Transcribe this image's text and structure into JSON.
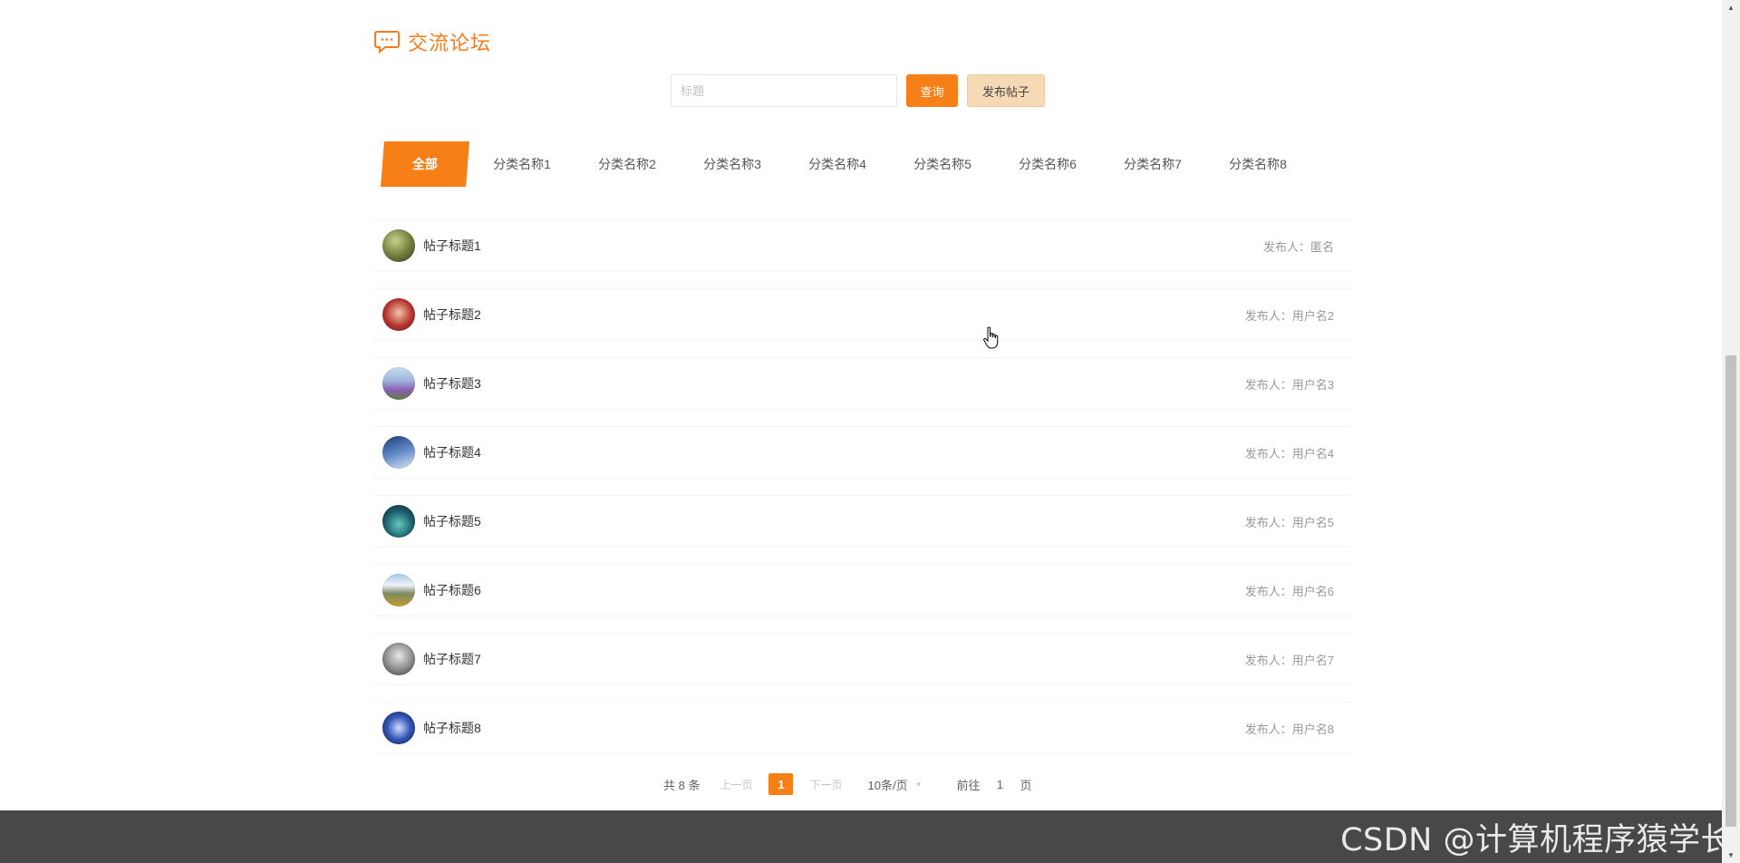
{
  "header": {
    "title": "交流论坛",
    "icon": "chat-bubble-icon"
  },
  "search": {
    "placeholder": "标题",
    "value": "",
    "query_label": "查询",
    "post_label": "发布帖子"
  },
  "categories": {
    "active": "全部",
    "items": [
      "分类名称1",
      "分类名称2",
      "分类名称3",
      "分类名称4",
      "分类名称5",
      "分类名称6",
      "分类名称7",
      "分类名称8"
    ]
  },
  "posts": [
    {
      "title": "帖子标题1",
      "author": "发布人：匿名"
    },
    {
      "title": "帖子标题2",
      "author": "发布人：用户名2"
    },
    {
      "title": "帖子标题3",
      "author": "发布人：用户名3"
    },
    {
      "title": "帖子标题4",
      "author": "发布人：用户名4"
    },
    {
      "title": "帖子标题5",
      "author": "发布人：用户名5"
    },
    {
      "title": "帖子标题6",
      "author": "发布人：用户名6"
    },
    {
      "title": "帖子标题7",
      "author": "发布人：用户名7"
    },
    {
      "title": "帖子标题8",
      "author": "发布人：用户名8"
    }
  ],
  "pagination": {
    "total": "共 8 条",
    "prev": "上一页",
    "current": "1",
    "next": "下一页",
    "page_size": "10条/页",
    "goto_prefix": "前往",
    "goto_value": "1",
    "goto_suffix": "页"
  },
  "watermark": "CSDN @计算机程序猿学长",
  "colors": {
    "accent": "#f67f17",
    "post_button_bg": "#f6d9b5",
    "footer": "#484848"
  }
}
